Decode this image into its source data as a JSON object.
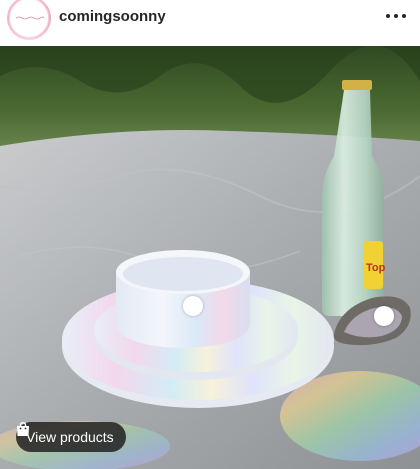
{
  "post": {
    "username": "comingsoonny",
    "more_icon": "more-horizontal-icon",
    "view_products_label": "View products",
    "view_products_icon": "shopping-bag-icon"
  },
  "photo_content": {
    "bottle_label_text": "Top"
  }
}
